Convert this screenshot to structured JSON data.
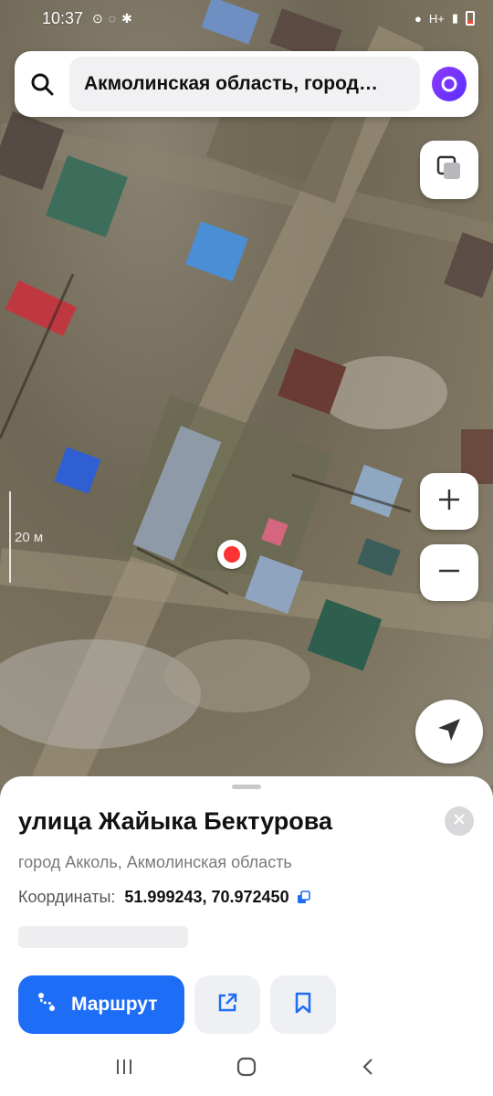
{
  "status_bar": {
    "time": "10:37",
    "left_icons": [
      "alarm-icon",
      "whatsapp-icon",
      "notification-icon"
    ],
    "right_icons": [
      "location-icon",
      "signal-icon",
      "battery-icon"
    ],
    "network_label": "H+"
  },
  "search": {
    "query": "Акмолинская область, город…",
    "search_icon": "search-icon",
    "assistant_icon": "alice-icon"
  },
  "map": {
    "scale_label": "20 м",
    "layers_icon": "layers-icon",
    "zoom_in_label": "+",
    "zoom_out_label": "−",
    "locate_icon": "navigation-arrow-icon",
    "accent_color": "#f33333"
  },
  "place_card": {
    "title": "улица Жайыка Бектурова",
    "subtitle": "город Акколь, Акмолинская область",
    "coords_label": "Координаты:",
    "coords_value": "51.999243, 70.972450",
    "route_label": "Маршрут",
    "route_color": "#1e6df6",
    "share_icon": "share-icon",
    "bookmark_icon": "bookmark-icon",
    "close_icon": "close-icon"
  },
  "nav_bar": {
    "items": [
      "recent-apps-icon",
      "home-icon",
      "back-icon"
    ]
  }
}
